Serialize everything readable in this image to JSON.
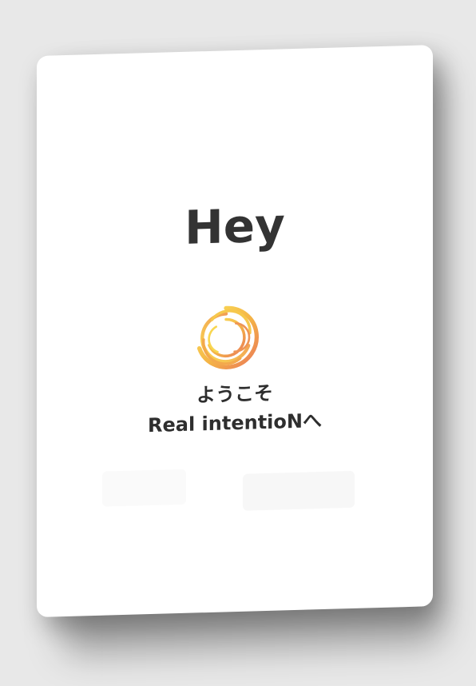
{
  "card": {
    "title": "Hey",
    "welcome_line1": "ようこそ",
    "welcome_line2": "Real intentioNへ"
  },
  "logo": {
    "icon": "swirl-logo-icon",
    "colors": [
      "#f7d54a",
      "#f2b046",
      "#ec7f55"
    ]
  },
  "colors": {
    "background": "#e8e8e8",
    "card": "#ffffff",
    "text": "#333333"
  }
}
